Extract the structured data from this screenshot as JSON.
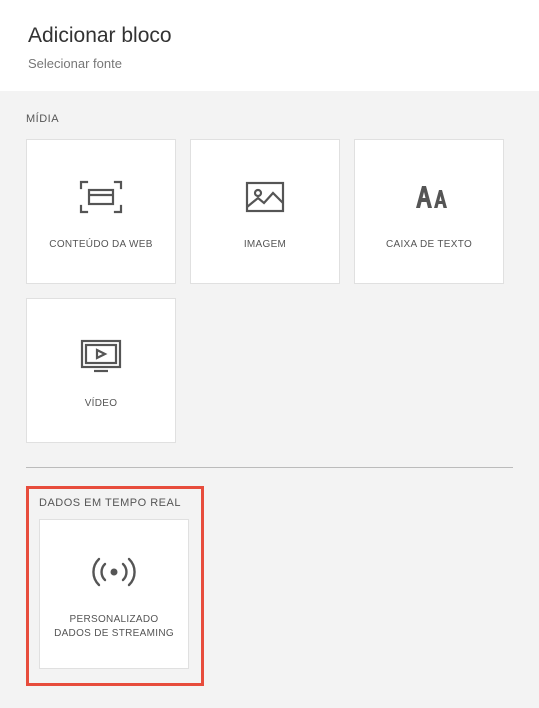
{
  "header": {
    "title": "Adicionar bloco",
    "subtitle": "Selecionar fonte"
  },
  "sections": {
    "media": {
      "label": "MÍDIA",
      "tiles": {
        "web": "CONTEÚDO DA WEB",
        "image": "IMAGEM",
        "textbox": "CAIXA DE TEXTO",
        "video": "VÍDEO"
      }
    },
    "realtime": {
      "label": "DADOS EM TEMPO REAL",
      "tiles": {
        "custom_line1": "PERSONALIZADO",
        "custom_line2": "DADOS DE STREAMING"
      }
    }
  }
}
